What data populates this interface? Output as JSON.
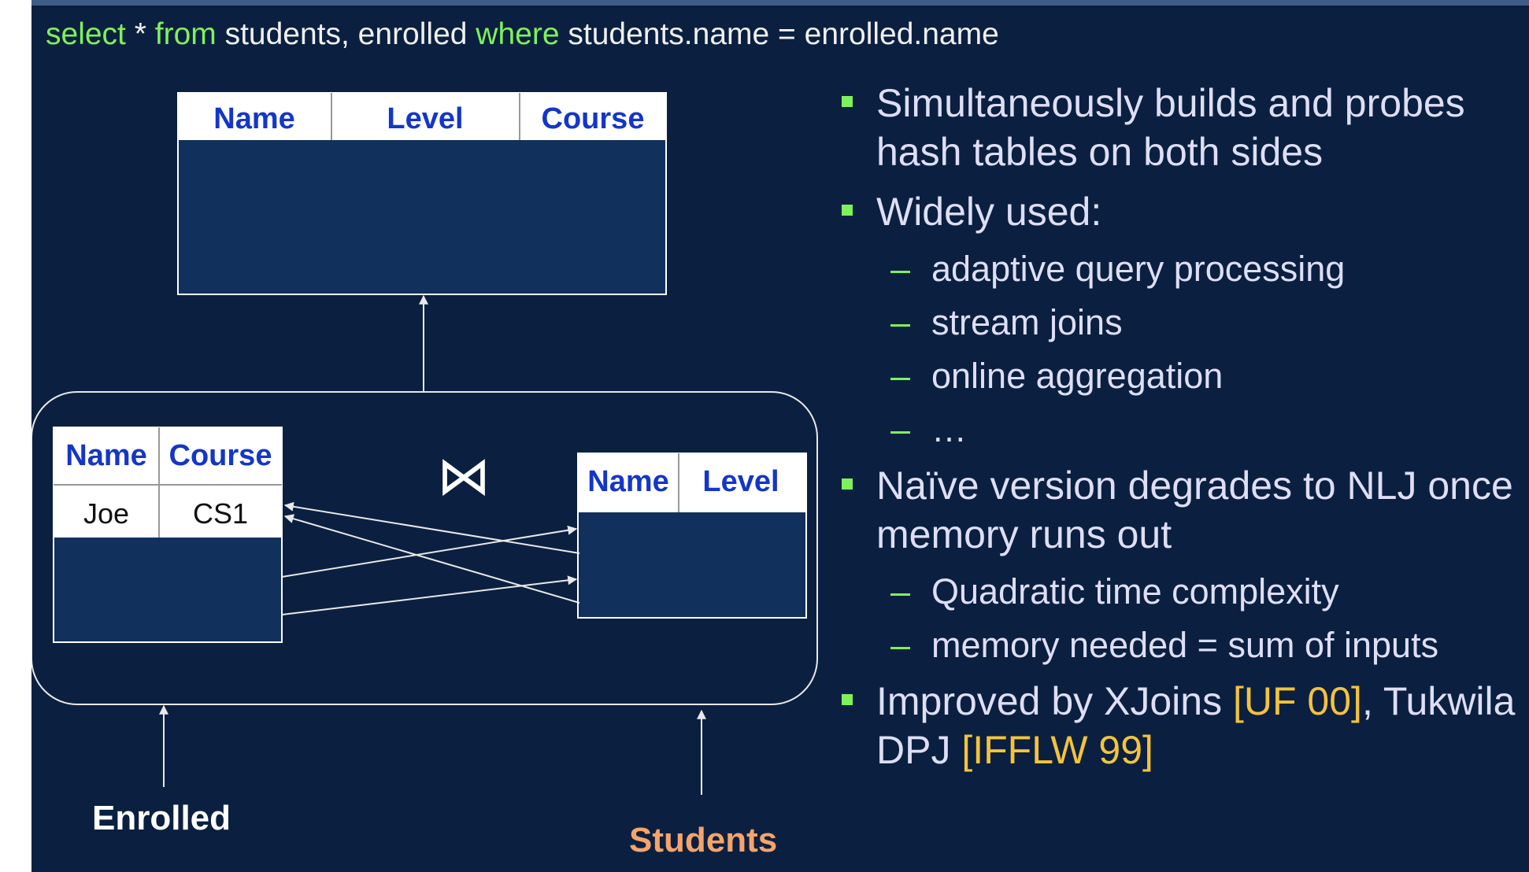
{
  "query": {
    "kw_select": "select",
    "star": " * ",
    "kw_from": "from",
    "tables": " students, enrolled ",
    "kw_where": "where",
    "condition": " students.name = enrolled.name"
  },
  "output_table": {
    "headers": [
      "Name",
      "Level",
      "Course"
    ]
  },
  "enrolled_table": {
    "headers": [
      "Name",
      "Course"
    ],
    "rows": [
      [
        "Joe",
        "CS1"
      ]
    ]
  },
  "students_table": {
    "headers": [
      "Name",
      "Level"
    ]
  },
  "join_symbol": "⋈",
  "labels": {
    "enrolled": "Enrolled",
    "students": "Students"
  },
  "colors": {
    "background": "#0b2040",
    "table_body": "#12305c",
    "keyword": "#7ef25a",
    "header_text": "#1436c8",
    "citation": "#f5c33a",
    "students_label": "#f5a46a"
  },
  "bullets": [
    {
      "text": "Simultaneously builds and probes hash tables on both sides"
    },
    {
      "text": "Widely used:",
      "subs": [
        "adaptive query processing",
        "stream joins",
        "online aggregation",
        "…"
      ]
    },
    {
      "text": "Naïve version degrades to NLJ once memory runs out",
      "subs": [
        "Quadratic time complexity",
        "memory needed = sum of inputs"
      ]
    },
    {
      "text": "Improved by XJoins ",
      "cite1": "[UF 00]",
      "mid": ", Tukwila DPJ ",
      "cite2": "[IFFLW 99]"
    }
  ]
}
